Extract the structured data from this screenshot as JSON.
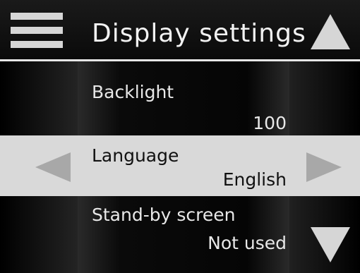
{
  "header": {
    "title": "Display settings",
    "menu_icon": "hamburger-menu-icon",
    "up_icon": "triangle-up-icon"
  },
  "items": [
    {
      "label": "Backlight",
      "value": "100"
    },
    {
      "label": "Language",
      "value": "English",
      "selected": true
    },
    {
      "label": "Stand-by screen",
      "value": "Not used"
    }
  ],
  "controls": {
    "left_icon": "triangle-left-icon",
    "right_icon": "triangle-right-icon",
    "down_icon": "triangle-down-icon"
  },
  "colors": {
    "background": "#000000",
    "selected_row": "#d9d9d9",
    "icon": "#d6d6d6",
    "arrow_disabled": "#a8a8a8"
  }
}
